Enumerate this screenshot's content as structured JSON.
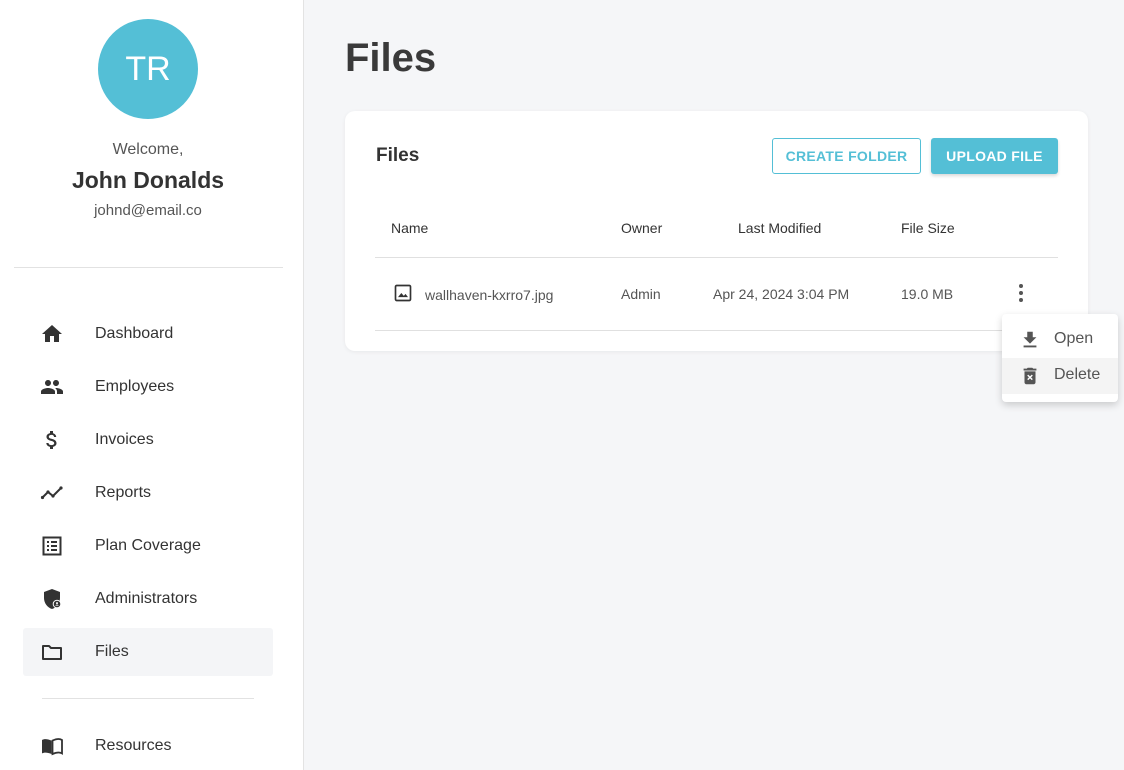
{
  "sidebar": {
    "avatar_initials": "TR",
    "welcome_text": "Welcome,",
    "user_name": "John Donalds",
    "user_email": "johnd@email.co",
    "items": [
      {
        "label": "Dashboard",
        "icon": "home-icon"
      },
      {
        "label": "Employees",
        "icon": "people-icon"
      },
      {
        "label": "Invoices",
        "icon": "dollar-icon"
      },
      {
        "label": "Reports",
        "icon": "trend-icon"
      },
      {
        "label": "Plan Coverage",
        "icon": "list-icon"
      },
      {
        "label": "Administrators",
        "icon": "admin-shield-icon"
      },
      {
        "label": "Files",
        "icon": "folder-icon",
        "active": true
      },
      {
        "label": "Resources",
        "icon": "book-icon"
      }
    ]
  },
  "main": {
    "page_title": "Files",
    "card": {
      "title": "Files",
      "create_folder_label": "CREATE FOLDER",
      "upload_file_label": "UPLOAD FILE",
      "columns": [
        "Name",
        "Owner",
        "Last Modified",
        "File Size"
      ],
      "rows": [
        {
          "name": "wallhaven-kxrro7.jpg",
          "owner": "Admin",
          "last_modified": "Apr 24, 2024 3:04 PM",
          "file_size": "19.0 MB",
          "icon": "image-icon"
        }
      ]
    },
    "context_menu": {
      "items": [
        {
          "label": "Open",
          "icon": "download-icon"
        },
        {
          "label": "Delete",
          "icon": "trash-icon"
        }
      ]
    }
  },
  "colors": {
    "accent": "#54bfd6",
    "background": "#f5f6f8",
    "sidebar_active": "#f4f5f7"
  }
}
